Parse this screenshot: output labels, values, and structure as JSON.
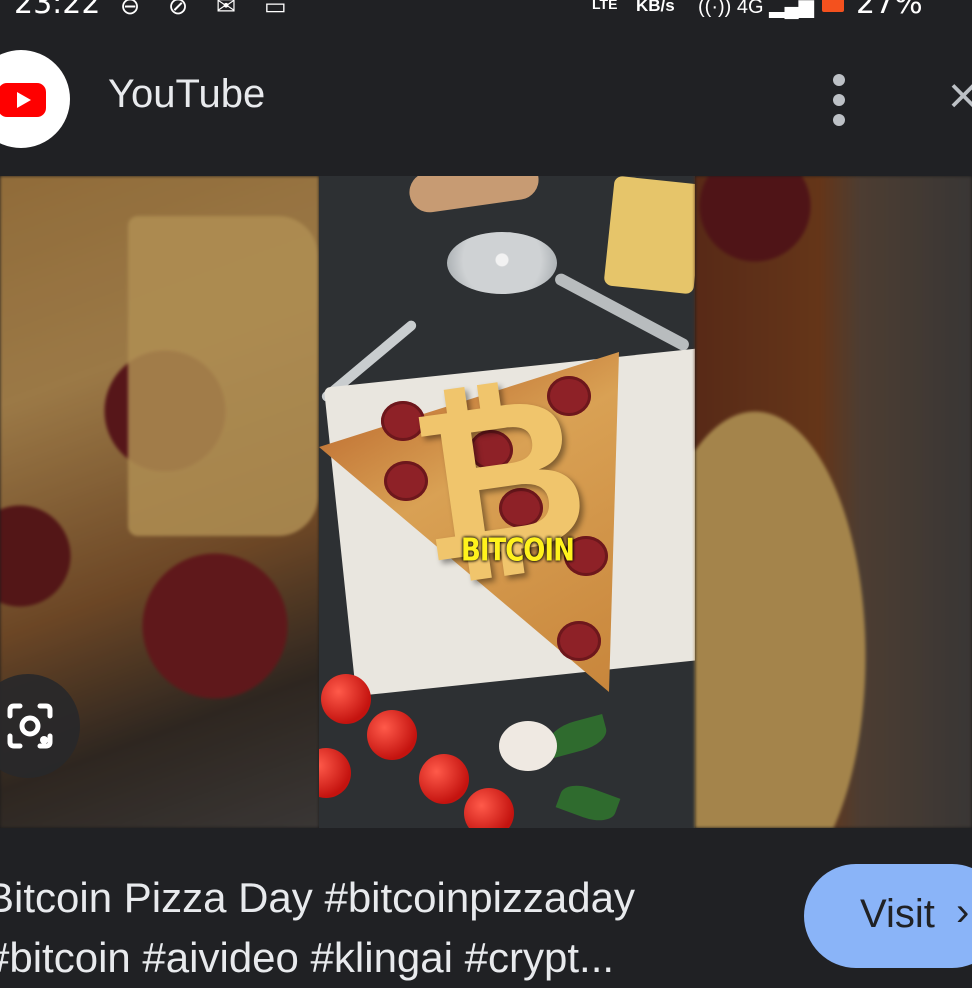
{
  "status_bar": {
    "time": "23:22",
    "network_type": "LTE",
    "speed_unit": "KB/s",
    "signal": "4G",
    "battery_percent": "27%"
  },
  "header": {
    "app_name": "YouTube",
    "icons": [
      "youtube-logo-icon",
      "more-vert-icon",
      "close-icon"
    ]
  },
  "media": {
    "overlay_label": "BITCOIN",
    "btc_symbol": "₿",
    "lens_icon": "lens-camera-icon"
  },
  "footer": {
    "caption_line1": "Bitcoin Pizza Day #bitcoinpizzaday",
    "caption_line2": "#bitcoin #aivideo #klingai #crypt...",
    "visit_label": "Visit",
    "visit_icon": "chevron-right-icon"
  },
  "colors": {
    "background": "#202124",
    "accent_button": "#8ab4f8",
    "youtube_red": "#ff0000",
    "overlay_text": "#fff21c"
  }
}
